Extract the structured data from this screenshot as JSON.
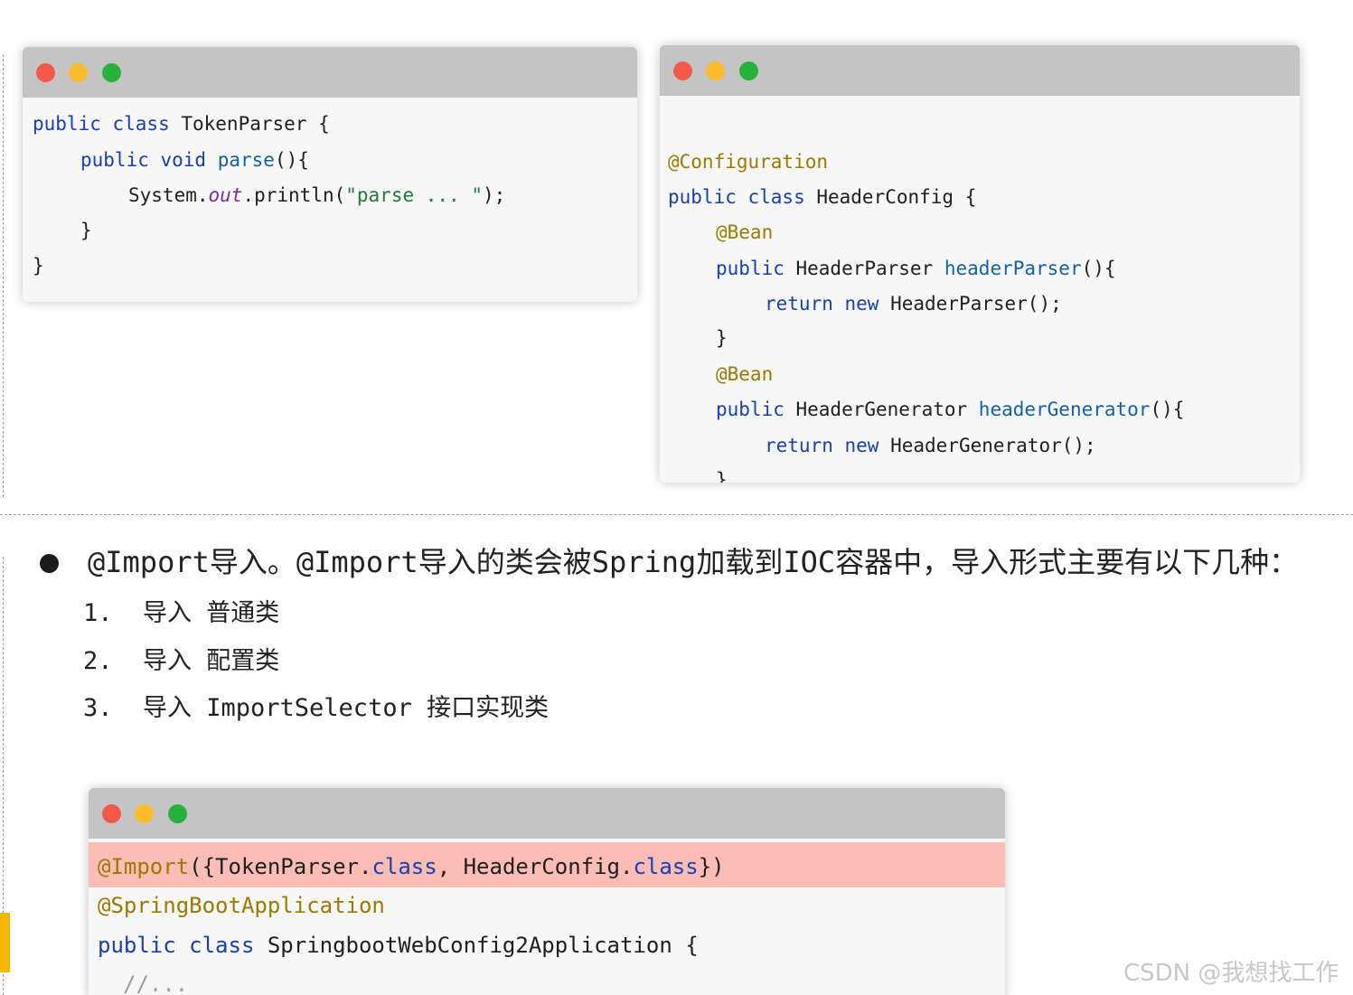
{
  "code_windows": {
    "token_parser": {
      "lines": {
        "l1": {
          "kw": "public class",
          "rest": " TokenParser {"
        },
        "l2": {
          "kw": "public void",
          "fn": "parse",
          "rest": "(){"
        },
        "l3": {
          "pre": "System.",
          "italic": "out",
          "mid": ".println(",
          "str": "\"parse ... \"",
          "end": ");"
        },
        "l4": "}",
        "l5": "}"
      }
    },
    "header_config": {
      "lines": {
        "l1": "@Configuration",
        "l2": {
          "kw": "public class",
          "rest": " HeaderConfig {"
        },
        "l3": "@Bean",
        "l4": {
          "kw": "public",
          "type": " HeaderParser ",
          "fn": "headerParser",
          "rest": "(){"
        },
        "l5": {
          "kw": "return new",
          "rest": " HeaderParser();"
        },
        "l6": "}",
        "l7": "@Bean",
        "l8": {
          "kw": "public",
          "type": " HeaderGenerator ",
          "fn": "headerGenerator",
          "rest": "(){"
        },
        "l9": {
          "kw": "return new",
          "rest": " HeaderGenerator();"
        },
        "l10": "}",
        "l11": "}"
      }
    },
    "spring_app": {
      "lines": {
        "l1": {
          "ann": "@Import",
          "a": "({TokenParser.",
          "kw1": "class",
          "b": ", HeaderConfig.",
          "kw2": "class",
          "c": "})"
        },
        "l2": "@SpringBootApplication",
        "l3": {
          "kw": "public class",
          "rest": " SpringbootWebConfig2Application {"
        },
        "l4": "//..."
      }
    }
  },
  "bullet": {
    "text": "@Import导入。@Import导入的类会被Spring加载到IOC容器中，导入形式主要有以下几种："
  },
  "list": [
    {
      "num": "1.",
      "text": "导入 普通类"
    },
    {
      "num": "2.",
      "text": "导入 配置类"
    },
    {
      "num": "3.",
      "text": "导入 ImportSelector 接口实现类"
    }
  ],
  "watermark": "CSDN @我想找工作",
  "colors": {
    "titlebar": "#c4c4c4",
    "close": "#f2584b",
    "minimize": "#fbbc2c",
    "maximize": "#27b23d",
    "highlight": "#fbbcb6",
    "marker": "#f5b800"
  }
}
